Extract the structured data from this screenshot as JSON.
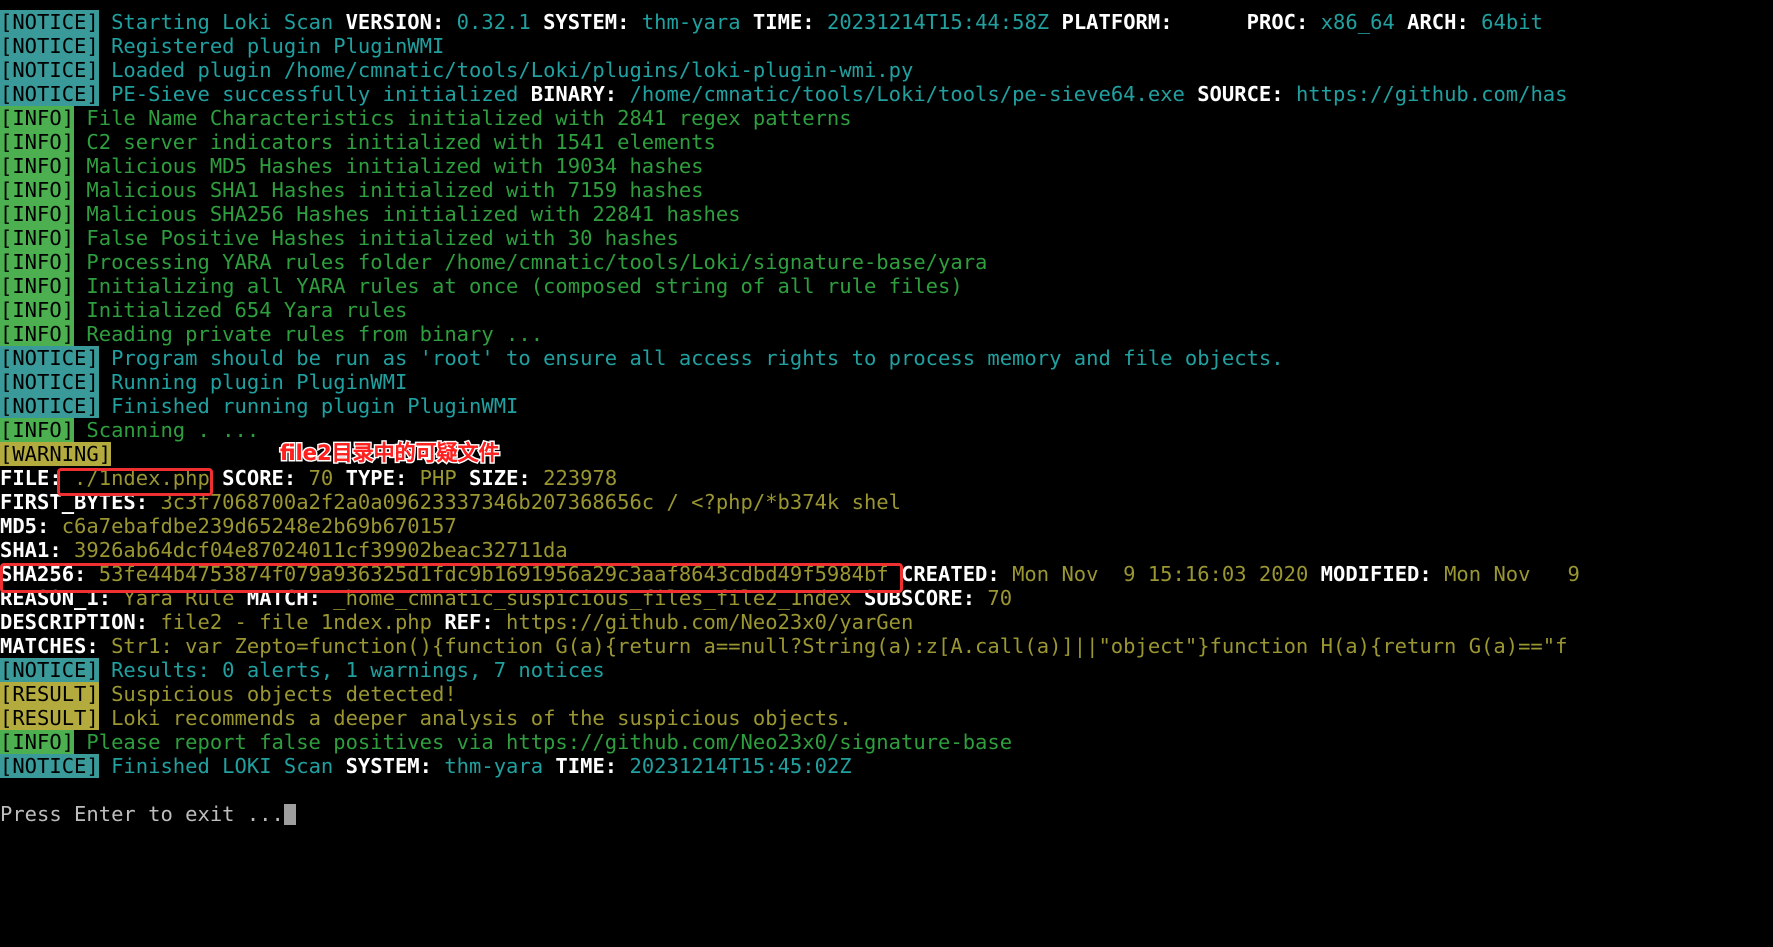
{
  "terminal": {
    "background": "#000000",
    "cursor_char": "block",
    "prompt": "Press Enter to exit ...",
    "colors": {
      "notice_bg": "#3a9a9a",
      "info_bg": "#4caf50",
      "warning_bg": "#b3ab3e",
      "result_bg": "#b3ab3e",
      "teal_text": "#21a0a0",
      "green_text": "#2e9e3e",
      "olive_text": "#9a9632",
      "key_text": "#ffffff",
      "annotation_red": "#ff2020"
    }
  },
  "tags": {
    "notice": "[NOTICE]",
    "info": "[INFO]",
    "warning": "[WARNING]",
    "result": "[RESULT]"
  },
  "lines": {
    "l1": {
      "msg": " Starting Loki Scan ",
      "k_version": "VERSION:",
      "v_version": " 0.32.1 ",
      "k_system": "SYSTEM:",
      "v_system": " thm-yara ",
      "k_time": "TIME:",
      "v_time": " 20231214T15:44:58Z ",
      "k_platform": "PLATFORM:",
      "v_platform": "      ",
      "k_proc": "PROC:",
      "v_proc": " x86_64 ",
      "k_arch": "ARCH:",
      "v_arch": " 64bit"
    },
    "l2": " Registered plugin PluginWMI",
    "l3": " Loaded plugin /home/cmnatic/tools/Loki/plugins/loki-plugin-wmi.py",
    "l4": {
      "msg": " PE-Sieve successfully initialized ",
      "k_binary": "BINARY:",
      "v_binary": " /home/cmnatic/tools/Loki/tools/pe-sieve64.exe ",
      "k_source": "SOURCE:",
      "v_source": " https://github.com/has"
    },
    "l5": " File Name Characteristics initialized with 2841 regex patterns",
    "l6": " C2 server indicators initialized with 1541 elements",
    "l7": " Malicious MD5 Hashes initialized with 19034 hashes",
    "l8": " Malicious SHA1 Hashes initialized with 7159 hashes",
    "l9": " Malicious SHA256 Hashes initialized with 22841 hashes",
    "l10": " False Positive Hashes initialized with 30 hashes",
    "l11": " Processing YARA rules folder /home/cmnatic/tools/Loki/signature-base/yara",
    "l12": " Initializing all YARA rules at once (composed string of all rule files)",
    "l13": " Initialized 654 Yara rules",
    "l14": " Reading private rules from binary ...",
    "l15": " Program should be run as 'root' to ensure all access rights to process memory and file objects.",
    "l16": " Running plugin PluginWMI",
    "l17": " Finished running plugin PluginWMI",
    "l18": " Scanning . ...",
    "l19": "",
    "file_line": {
      "k_file": "FILE:",
      "v_file": " ./1ndex.php ",
      "k_score": "SCORE:",
      "v_score": " 70 ",
      "k_type": "TYPE:",
      "v_type": " PHP ",
      "k_size": "SIZE:",
      "v_size": " 223978"
    },
    "first_bytes": {
      "key": "FIRST_BYTES:",
      "value": " 3c3f7068700a2f2a0a09623337346b207368656c / <?php/*b374k shel"
    },
    "md5": {
      "key": "MD5:",
      "value": " c6a7ebafdbe239d65248e2b69b670157"
    },
    "sha1": {
      "key": "SHA1:",
      "value": " 3926ab64dcf04e87024011cf39902beac32711da"
    },
    "sha256": {
      "key": "SHA256:",
      "value": " 53fe44b4753874f079a936325d1fdc9b1691956a29c3aaf8643cdbd49f5984bf ",
      "k_created": "CREATED:",
      "v_created": " Mon Nov  9 15:16:03 2020 ",
      "k_modified": "MODIFIED:",
      "v_modified": " Mon Nov   9"
    },
    "reason": {
      "key": "REASON_1:",
      "value": " Yara Rule ",
      "k_match": "MATCH:",
      "v_match": " _home_cmnatic_suspicious_files_file2_1ndex ",
      "k_subscore": "SUBSCORE:",
      "v_subscore": " 70"
    },
    "description": {
      "key": "DESCRIPTION:",
      "value": " file2 - file 1ndex.php ",
      "k_ref": "REF:",
      "v_ref": " https://github.com/Neo23x0/yarGen"
    },
    "matches": {
      "key": "MATCHES:",
      "value": " Str1: var Zepto=function(){function G(a){return a==null?String(a):z[A.call(a)]||\"object\"}function H(a){return G(a)==\"f"
    },
    "results": " Results: 0 alerts, 1 warnings, 7 notices",
    "result1": " Suspicious objects detected!",
    "result2": " Loki recommends a deeper analysis of the suspicious objects.",
    "report": " Please report false positives via https://github.com/Neo23x0/signature-base",
    "finished": {
      "msg": " Finished LOKI Scan ",
      "k_system": "SYSTEM:",
      "v_system": " thm-yara ",
      "k_time": "TIME:",
      "v_time": " 20231214T15:45:02Z"
    }
  },
  "annotations": {
    "chinese_note": "file2目录中的可疑文件",
    "box_file_target": "./1ndex.php",
    "box_sha256_target": "53fe44b4753874f079a936325d1fdc9b1691956a29c3aaf8643cdbd49f5984bf"
  }
}
